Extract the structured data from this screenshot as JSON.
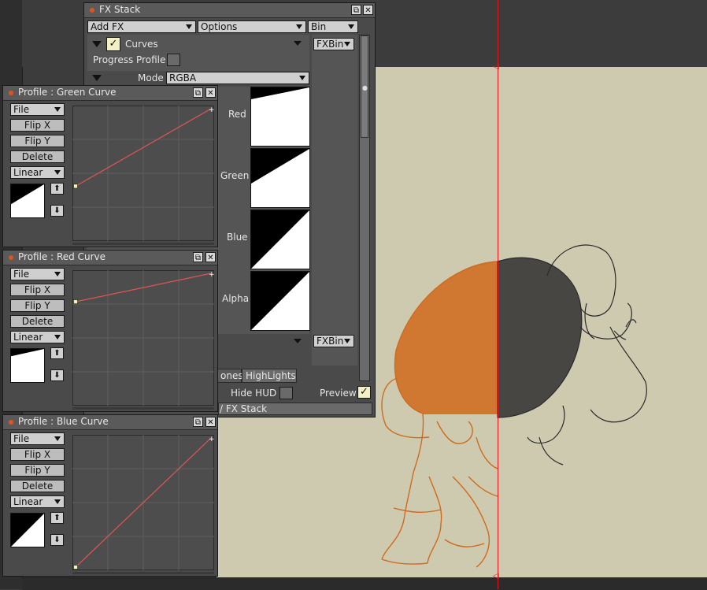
{
  "fx_stack": {
    "title": "FX Stack",
    "add_fx": "Add FX",
    "options": "Options",
    "bin": "Bin",
    "effect_name": "Curves",
    "effect_enabled": true,
    "fxbin_label": "FXBin",
    "fxbin_label_2": "FXBin",
    "progress_profile_label": "Progress Profile",
    "mode_label": "Mode",
    "mode_value": "RGBA",
    "channels": [
      "Red",
      "Green",
      "Blue",
      "Alpha"
    ],
    "tabs": [
      "ones",
      "HighLights"
    ],
    "hide_hud_label": "Hide HUD",
    "preview_label": "Preview",
    "preview_enabled": true,
    "status_text": "/ FX Stack"
  },
  "profiles": [
    {
      "title": "Profile : Green Curve",
      "file": "File",
      "flip_x": "Flip X",
      "flip_y": "Flip Y",
      "delete": "Delete",
      "interp": "Linear",
      "curve": {
        "start": [
          0,
          0.4
        ],
        "end": [
          1,
          1
        ]
      }
    },
    {
      "title": "Profile : Red Curve",
      "file": "File",
      "flip_x": "Flip X",
      "flip_y": "Flip Y",
      "delete": "Delete",
      "interp": "Linear",
      "curve": {
        "start": [
          0,
          0.78
        ],
        "end": [
          1,
          1
        ]
      }
    },
    {
      "title": "Profile : Blue Curve",
      "file": "File",
      "flip_x": "Flip X",
      "flip_y": "Flip Y",
      "delete": "Delete",
      "interp": "Linear",
      "curve": {
        "start": [
          0,
          0
        ],
        "end": [
          1,
          1
        ]
      }
    }
  ],
  "colors": {
    "canvas_bg": "#cdcab0",
    "wipe_line": "#e0161b",
    "curve_line": "#e25555",
    "orange_sketch": "#d06a1c",
    "dark_sketch": "#2a2a2a"
  },
  "icons": [
    "restore-icon",
    "close-icon",
    "arrow-up-icon",
    "arrow-down-icon",
    "checkmark-icon",
    "chevron-down-icon"
  ]
}
